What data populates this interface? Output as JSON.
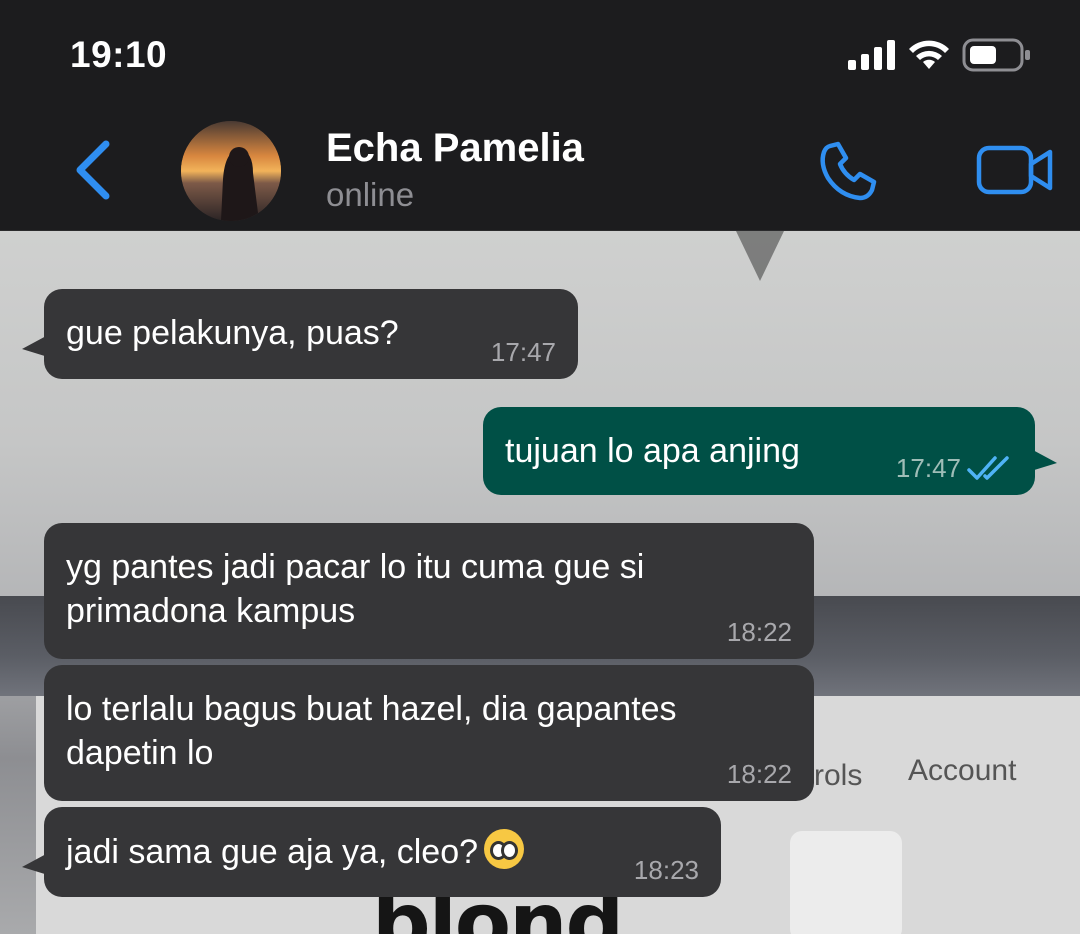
{
  "status_bar": {
    "time": "19:10"
  },
  "header": {
    "contact_name": "Echa Pamelia",
    "contact_status": "online"
  },
  "background": {
    "tab_controls_text": "rols",
    "tab_account_text": "Account",
    "poster_text": "blond"
  },
  "messages": [
    {
      "direction": "incoming",
      "text": "gue pelakunya, puas?",
      "time": "17:47"
    },
    {
      "direction": "outgoing",
      "text": "tujuan lo apa anjing",
      "time": "17:47",
      "read": true
    },
    {
      "direction": "incoming",
      "text": "yg pantes jadi pacar lo itu cuma gue si\nprimadona kampus",
      "time": "18:22"
    },
    {
      "direction": "incoming",
      "text": "lo terlalu bagus buat hazel, dia gapantes\ndapetin lo",
      "time": "18:22"
    },
    {
      "direction": "incoming",
      "text": "jadi sama gue aja ya, cleo?",
      "time": "18:23",
      "emoji": "pleading-face"
    }
  ],
  "colors": {
    "incoming_bubble": "#363638",
    "outgoing_bubble": "#005046",
    "accent_blue": "#2f8ef0",
    "header_bg": "#1c1c1e"
  }
}
